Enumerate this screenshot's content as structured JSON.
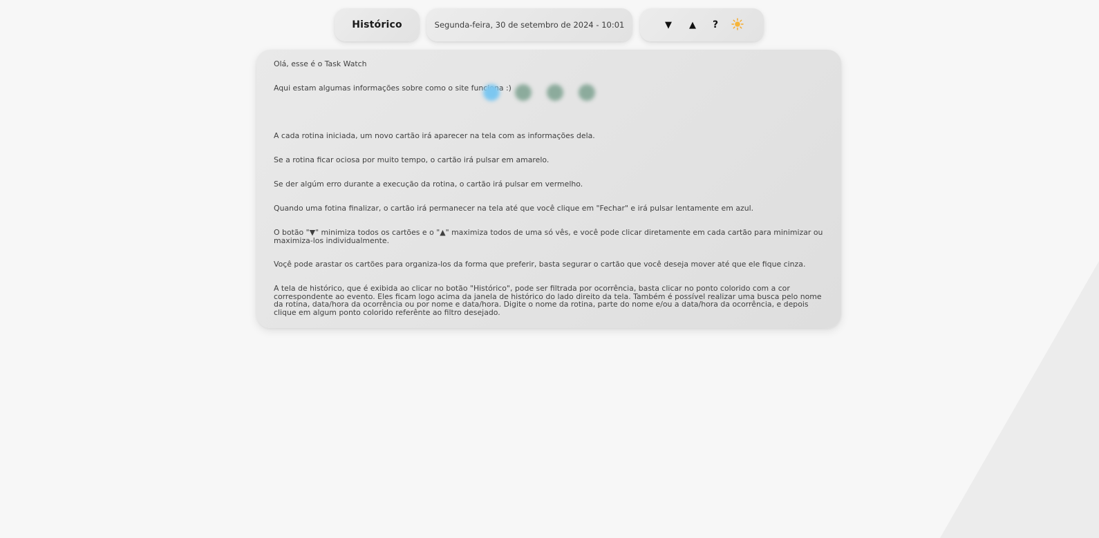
{
  "header": {
    "history_label": "Histórico",
    "datetime": "Segunda-feira, 30 de setembro de 2024 - 10:01",
    "controls": {
      "minimize_all": "▼",
      "maximize_all": "▲",
      "help": "?",
      "theme_icon": "sun-icon"
    }
  },
  "info": {
    "greeting": "Olá, esse é o Task Watch",
    "intro": "Aqui estam algumas informações sobre como o site funciona :)",
    "status_dots": [
      {
        "name": "blue-dot",
        "color": "#7cc7f0"
      },
      {
        "name": "green-dot-1",
        "color": "#8cab9c"
      },
      {
        "name": "green-dot-2",
        "color": "#8cab9c"
      },
      {
        "name": "green-dot-3",
        "color": "#8cab9c"
      }
    ],
    "paragraphs": [
      "A cada rotina iniciada, um novo cartão irá aparecer na tela com as informações dela.",
      "Se a rotina ficar ociosa por muito tempo, o cartão irá pulsar em amarelo.",
      "Se der algúm erro durante a execução da rotina, o cartão irá pulsar em vermelho.",
      "Quando uma fotina finalizar, o cartão irá permanecer na tela até que você clique em \"Fechar\" e irá pulsar lentamente em azul.",
      "O botão \"▼\" minimiza todos os cartões e o \"▲\" maximiza todos de uma só vês, e você pode clicar diretamente em cada cartão para minimizar ou maximiza-los individualmente.",
      "Voçê pode arastar os cartões para organiza-los da forma que preferir, basta segurar o cartão que você deseja mover até que ele fique cinza.",
      "A tela de histórico, que é exibida ao clicar no botão \"Histórico\", pode ser filtrada por ocorrência, basta clicar no ponto colorido com a cor correspondente ao evento. Eles ficam logo acima da janela de histórico do lado direito da tela. Também é possível realizar uma busca pelo nome da rotina, data/hora da ocorrência ou por nome e data/hora. Digite o nome da rotina, parte do nome e/ou a data/hora da ocorrência, e depois clique em algum ponto colorido referênte ao filtro desejado."
    ]
  },
  "colors": {
    "background": "#f7f7f7",
    "panel": "#e4e4e4",
    "sun": "#f5a623",
    "blue_dot": "#7cc7f0",
    "green_dot": "#8cab9c"
  }
}
